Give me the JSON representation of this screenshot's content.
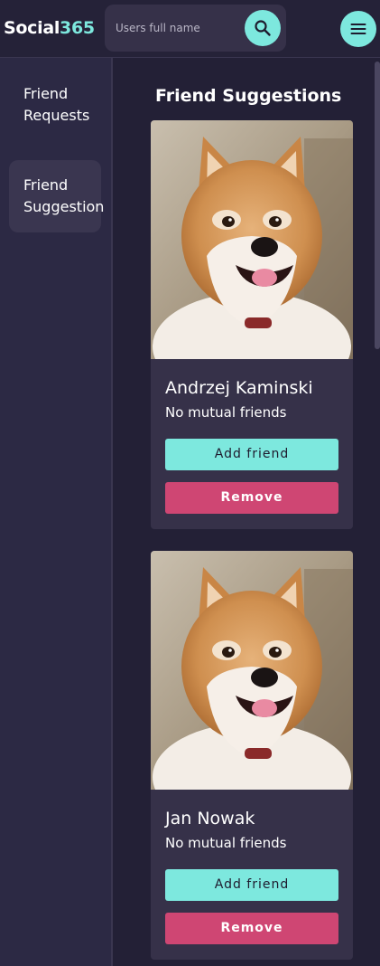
{
  "app": {
    "brand_part1": "Social",
    "brand_part2": "365",
    "accent_color": "#7de8de",
    "danger_color": "#cf4673"
  },
  "search": {
    "placeholder": "Users full name",
    "value": "",
    "button_icon": "search-icon"
  },
  "menu": {
    "icon": "hamburger-menu-icon"
  },
  "sidebar": {
    "items": [
      {
        "label": "Friend\nRequests",
        "active": false
      },
      {
        "label": "Friend\nSuggestion",
        "active": true
      }
    ]
  },
  "main": {
    "title": "Friend Suggestions",
    "cards": [
      {
        "name": "Andrzej Kaminski",
        "mutual": "No mutual friends",
        "add_label": "Add friend",
        "remove_label": "Remove",
        "photo": "shiba-inu-dog-photo"
      },
      {
        "name": "Jan Nowak",
        "mutual": "No mutual friends",
        "add_label": "Add friend",
        "remove_label": "Remove",
        "photo": "shiba-inu-dog-photo"
      }
    ]
  }
}
